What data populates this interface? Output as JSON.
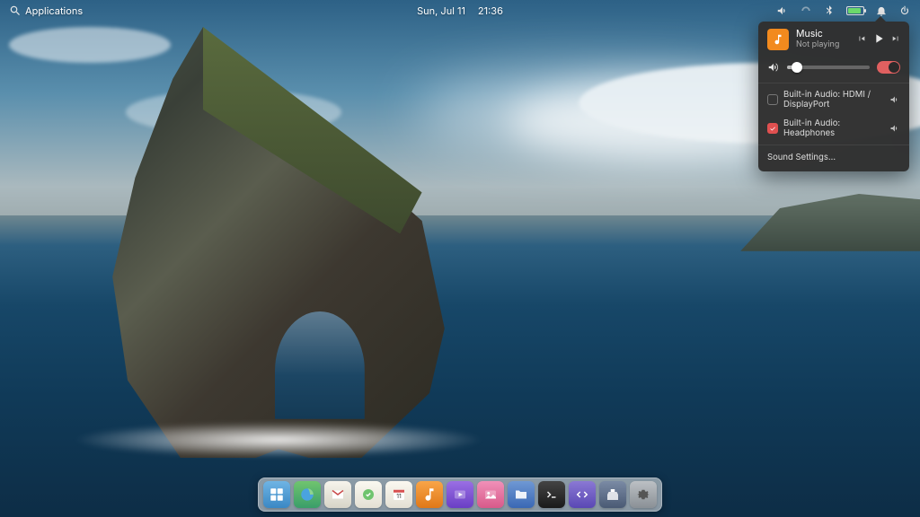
{
  "panel": {
    "applications_label": "Applications",
    "date": "Sun, Jul 11",
    "time": "21:36"
  },
  "sound_popover": {
    "media": {
      "app": "Music",
      "status": "Not playing"
    },
    "volume_percent": 12,
    "amplify_on": true,
    "devices": [
      {
        "label": "Built-in Audio: HDMI / DisplayPort",
        "active": false
      },
      {
        "label": "Built-in Audio: Headphones",
        "active": true
      }
    ],
    "settings_label": "Sound Settings…"
  },
  "dock": {
    "items": [
      {
        "name": "multitasking",
        "color": "#4da0d8"
      },
      {
        "name": "web-browser",
        "color": "#4aa3df"
      },
      {
        "name": "mail",
        "color": "#e8e8e4"
      },
      {
        "name": "tasks",
        "color": "#f7f7f2"
      },
      {
        "name": "calendar",
        "color": "#f7f7f2"
      },
      {
        "name": "music",
        "color": "#f28a1e"
      },
      {
        "name": "videos",
        "color": "#7a4fcf"
      },
      {
        "name": "photos",
        "color": "#e86a9a"
      },
      {
        "name": "files",
        "color": "#4b78c9"
      },
      {
        "name": "terminal",
        "color": "#2b2b2b"
      },
      {
        "name": "code",
        "color": "#6e5cc9"
      },
      {
        "name": "app-center",
        "color": "#5a6b8f"
      },
      {
        "name": "system-settings",
        "color": "#9aa0a6"
      }
    ]
  }
}
